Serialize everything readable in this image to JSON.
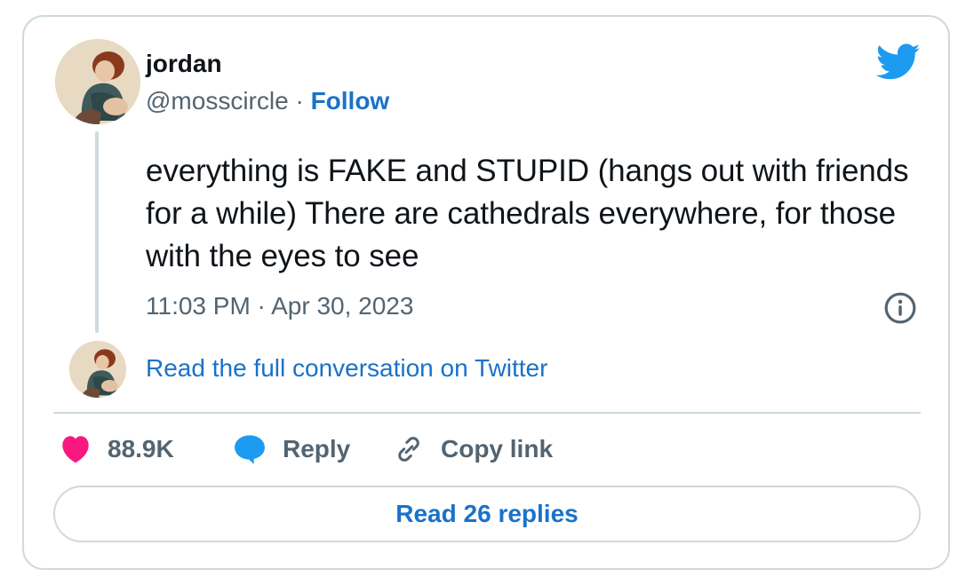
{
  "author": {
    "name": "jordan",
    "handle": "@mosscircle",
    "separator": "·",
    "follow_label": "Follow"
  },
  "tweet": {
    "text": "everything is FAKE and STUPID (hangs out with friends for a while) There are cathedrals everywhere, for those with the eyes to see",
    "timestamp": "11:03 PM · Apr 30, 2023"
  },
  "conversation": {
    "link_label": "Read the full conversation on Twitter"
  },
  "actions": {
    "likes_count": "88.9K",
    "reply_label": "Reply",
    "copy_link_label": "Copy link"
  },
  "replies_button": {
    "label": "Read 26 replies"
  },
  "icons": {
    "brand": "twitter-bird-icon",
    "info": "info-icon",
    "like": "heart-icon",
    "reply": "speech-bubble-icon",
    "copy": "link-icon"
  },
  "colors": {
    "brand_blue": "#1d9bf0",
    "link_blue": "#1a72c9",
    "like_pink": "#f91880",
    "text_primary": "#0f1419",
    "text_secondary": "#536471",
    "border": "#cfd9de"
  }
}
